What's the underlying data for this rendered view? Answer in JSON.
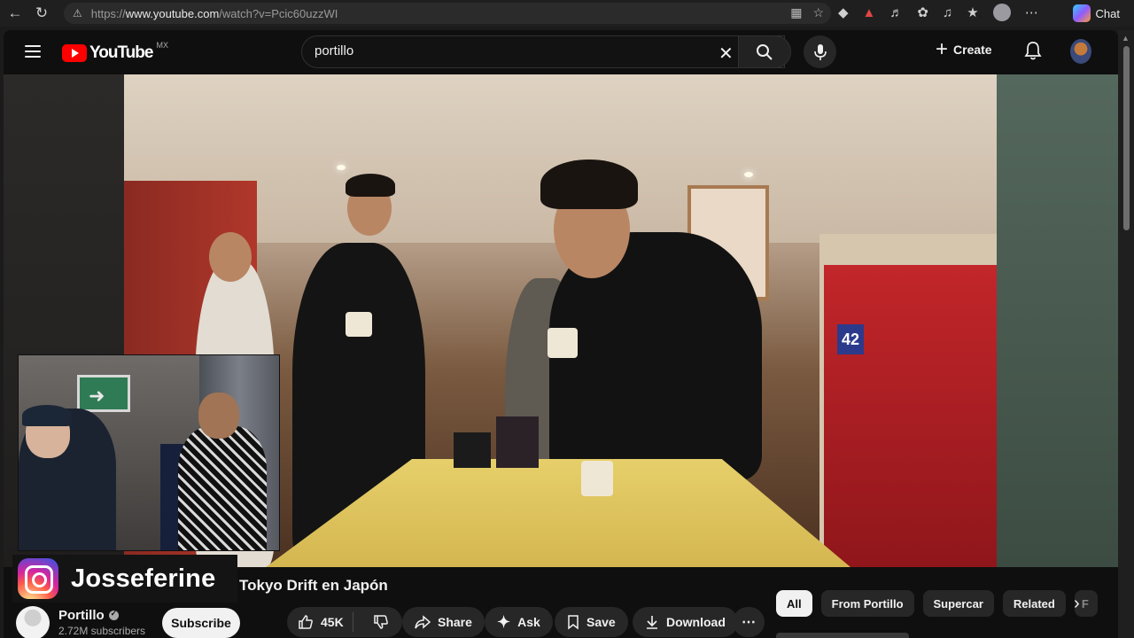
{
  "browser": {
    "url_prefix": "https://",
    "url_domain": "www.youtube.com",
    "url_path": "/watch?v=Pcic60uzzWI",
    "copilot_label": "Chat"
  },
  "masthead": {
    "logo_text": "YouTube",
    "country_code": "MX",
    "search_value": "portillo",
    "create_label": "Create"
  },
  "overlay": {
    "instagram_handle": "Josseferine"
  },
  "video": {
    "booth_number": "42",
    "title_visible": "Tokyo Drift en Japón"
  },
  "channel": {
    "name": "Portillo",
    "subscribers": "2.72M subscribers",
    "subscribe_label": "Subscribe"
  },
  "actions": {
    "likes": "45K",
    "share_label": "Share",
    "ask_label": "Ask",
    "save_label": "Save",
    "download_label": "Download"
  },
  "chips": [
    "All",
    "From Portillo",
    "Supercar",
    "Related",
    "F"
  ],
  "colors": {
    "brand_red": "#ff0000",
    "background": "#0f0f0f",
    "pill": "#272727"
  }
}
